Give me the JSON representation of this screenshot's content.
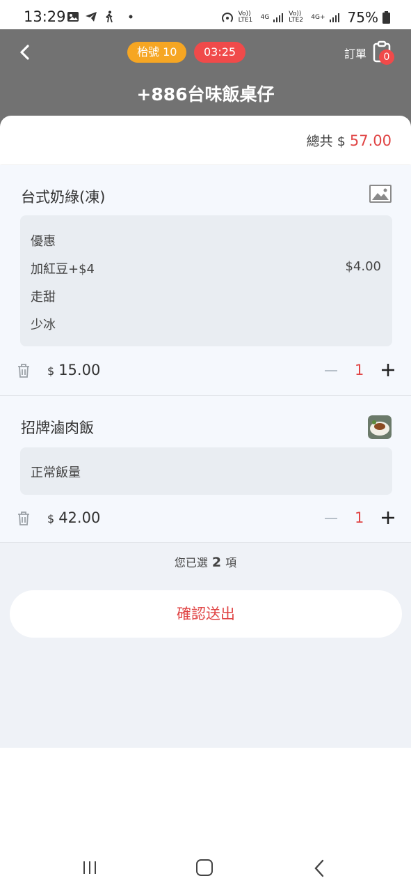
{
  "status_bar": {
    "time": "13:29",
    "left_icons": [
      "gallery-icon",
      "telegram-icon",
      "walking-icon",
      "dot-icon"
    ],
    "right_labels": [
      "Vo)) LTE1",
      "4G",
      "Vo)) LTE2",
      "4G+"
    ],
    "battery": "75%"
  },
  "header": {
    "queue_label": "枱號 10",
    "timer": "03:25",
    "orders_label": "訂單",
    "orders_count": "0",
    "shop_name": "+886台味飯桌仔"
  },
  "summary": {
    "total_label": "總共",
    "currency": "$",
    "total_amount": "57.00"
  },
  "items": [
    {
      "name": "台式奶綠(凍)",
      "thumbnail": "image-placeholder-icon",
      "options": [
        {
          "label": "優惠",
          "price": ""
        },
        {
          "label": "加紅豆+$4",
          "price": "$4.00"
        },
        {
          "label": "走甜",
          "price": ""
        },
        {
          "label": "少冰",
          "price": ""
        }
      ],
      "currency": "$",
      "price": "15.00",
      "quantity": "1"
    },
    {
      "name": "招牌滷肉飯",
      "thumbnail": "braised-pork-rice-photo",
      "options": [
        {
          "label": "正常飯量",
          "price": ""
        }
      ],
      "currency": "$",
      "price": "42.00",
      "quantity": "1"
    }
  ],
  "selection": {
    "prefix": "您已選",
    "count": "2",
    "suffix": "項"
  },
  "confirm_button": "確認送出",
  "colors": {
    "header_bg": "#727272",
    "accent_red": "#e04444",
    "queue_pill": "#f6a623",
    "timer_pill": "#f04a4a",
    "items_bg": "#eff2f7"
  }
}
